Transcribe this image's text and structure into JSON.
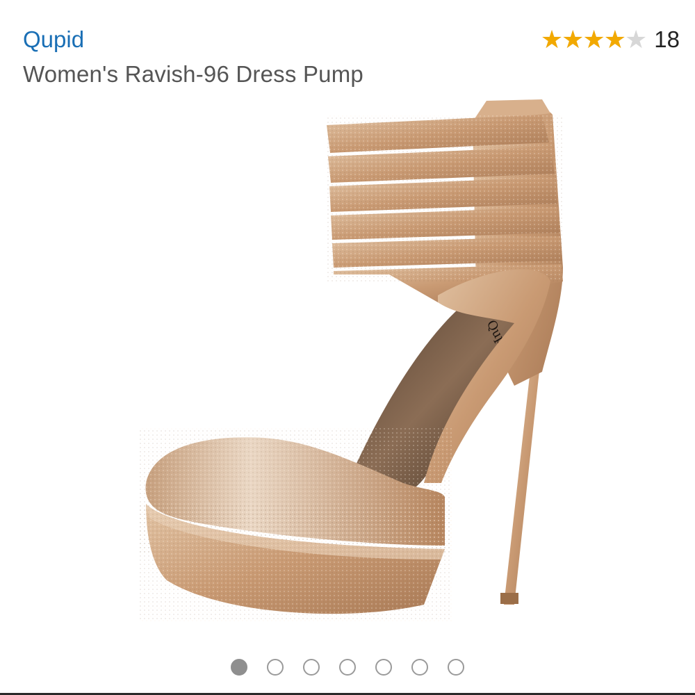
{
  "product": {
    "brand": "Qupid",
    "title": "Women's Ravish-96 Dress Pump",
    "rating": {
      "stars": 4,
      "out_of": 5,
      "count": "18",
      "icon": "star-icon"
    },
    "image_logo_text": "Qupid"
  },
  "carousel": {
    "total": 7,
    "active_index": 0
  },
  "colors": {
    "brand_link": "#1a6fb5",
    "star_fill": "#f2a900",
    "star_empty": "#d7d7d7",
    "shoe_gold": "#cfa57f"
  }
}
